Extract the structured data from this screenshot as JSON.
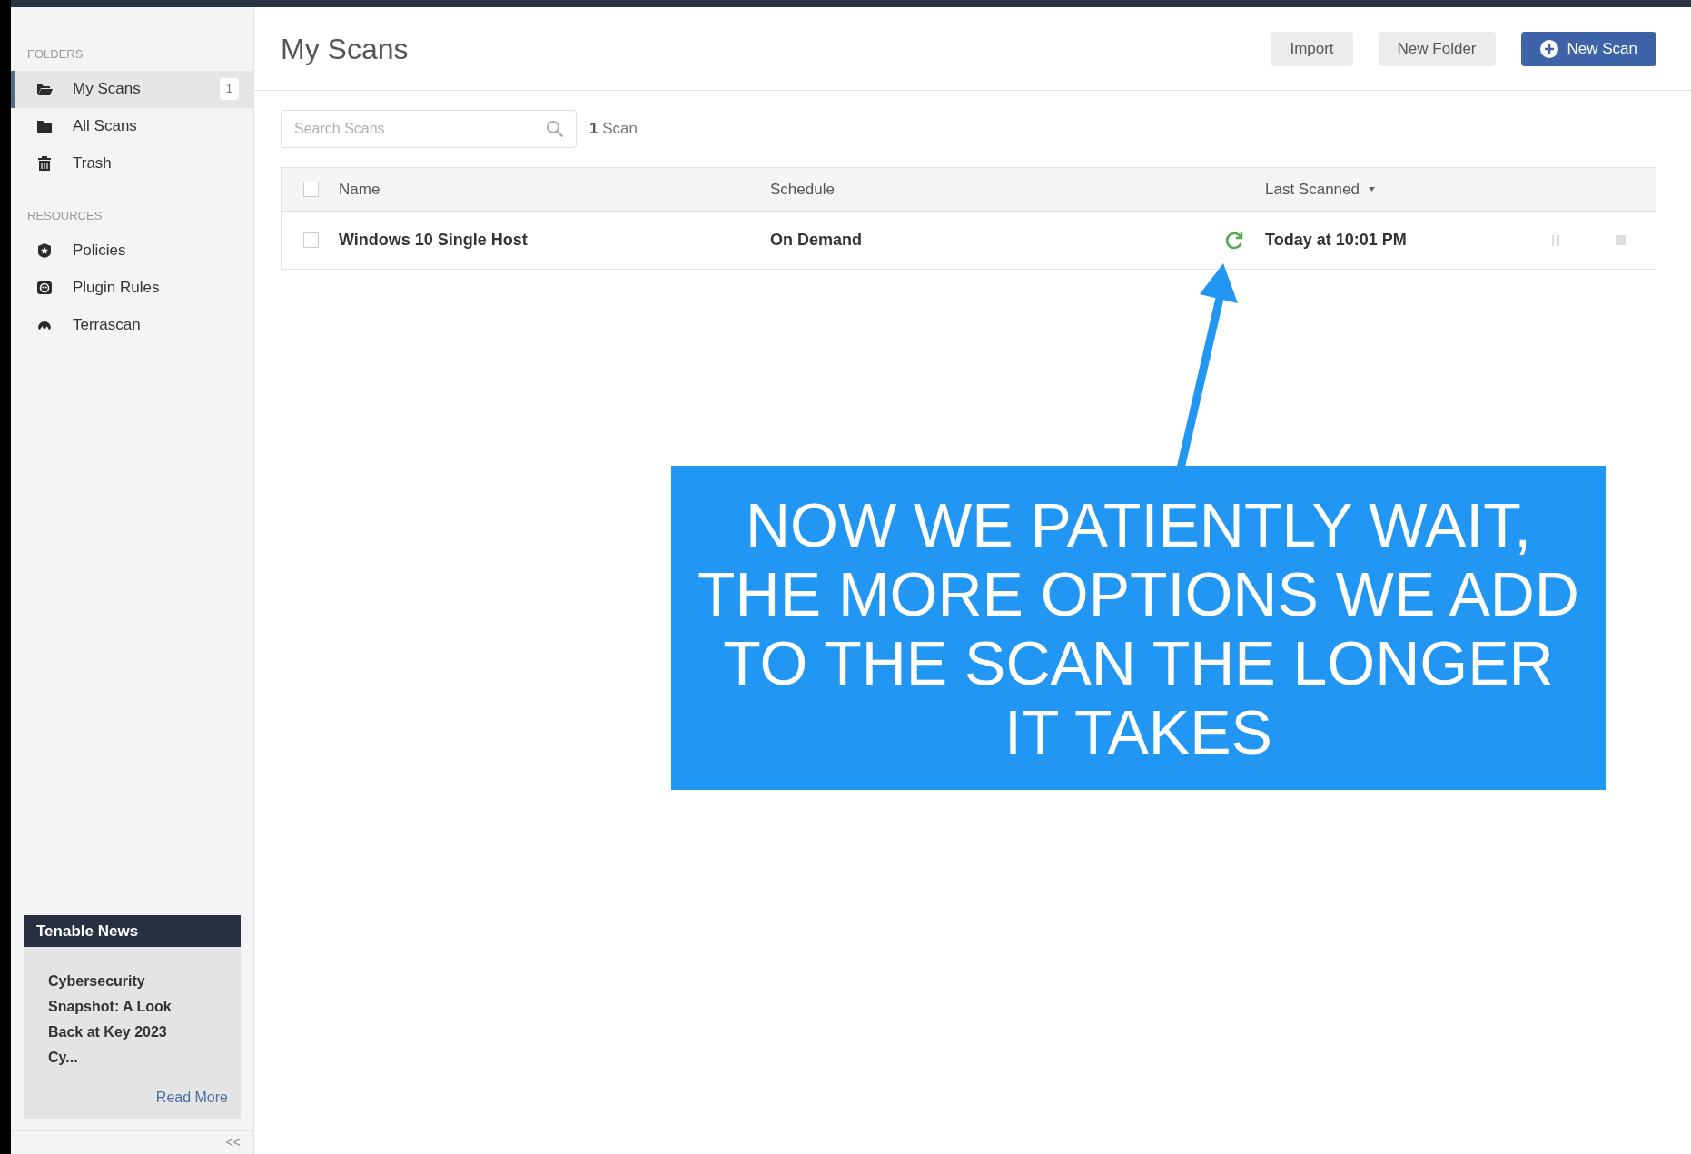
{
  "sidebar": {
    "sections": [
      {
        "heading": "FOLDERS",
        "items": [
          {
            "label": "My Scans",
            "selected": true,
            "count": "1"
          },
          {
            "label": "All Scans",
            "selected": false
          },
          {
            "label": "Trash",
            "selected": false
          }
        ]
      },
      {
        "heading": "RESOURCES",
        "items": [
          {
            "label": "Policies",
            "selected": false
          },
          {
            "label": "Plugin Rules",
            "selected": false
          },
          {
            "label": "Terrascan",
            "selected": false
          }
        ]
      }
    ],
    "news": {
      "title": "Tenable News",
      "headline": "Cybersecurity Snapshot: A Look Back at Key 2023 Cy...",
      "link": "Read More"
    },
    "collapse": "<<"
  },
  "header": {
    "title": "My Scans",
    "buttons": [
      {
        "label": "Import",
        "kind": "plain"
      },
      {
        "label": "New Folder",
        "kind": "plain"
      },
      {
        "label": "New Scan",
        "kind": "primary"
      }
    ]
  },
  "search": {
    "placeholder": "Search Scans"
  },
  "count": {
    "number": "1",
    "label": "Scan"
  },
  "table": {
    "all_checked": false,
    "columns": [
      {
        "label": "Name",
        "sorted": false
      },
      {
        "label": "Schedule",
        "sorted": false
      },
      {
        "label": "Last Scanned",
        "sorted": true
      }
    ],
    "rows": [
      {
        "checked": false,
        "name": "Windows 10 Single Host",
        "schedule": "On Demand",
        "running": true,
        "last_scanned": "Today at 10:01 PM"
      }
    ]
  },
  "callout": {
    "text": "NOW WE PATIENTLY WAIT, THE MORE OPTIONS WE ADD TO THE SCAN THE LONGER IT TAKES"
  }
}
